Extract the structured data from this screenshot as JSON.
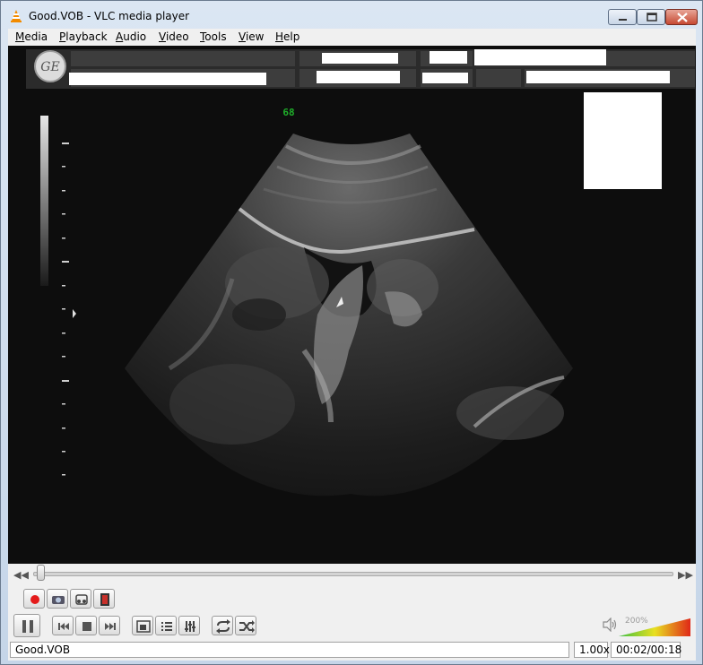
{
  "window": {
    "title": "Good.VOB - VLC media player",
    "icon": "vlc-cone-icon"
  },
  "menu": {
    "items": [
      {
        "accel": "M",
        "rest": "edia"
      },
      {
        "accel": "P",
        "rest": "layback"
      },
      {
        "accel": "A",
        "rest": "udio"
      },
      {
        "accel": "V",
        "rest": "ideo"
      },
      {
        "accel": "T",
        "rest": "ools"
      },
      {
        "accel": "V",
        "rest": "iew"
      },
      {
        "accel": "H",
        "rest": "elp"
      }
    ]
  },
  "video": {
    "logo_icon": "ge-logo",
    "overlay_label": "68",
    "overlay_color": "#1fae2a",
    "content": "ultrasound-scan"
  },
  "controls": {
    "seek_position": 0.011,
    "advanced_row": [
      "record-icon",
      "snapshot-icon",
      "loop-ab-icon",
      "frame-step-icon"
    ],
    "main_row": [
      "pause-icon",
      "previous-icon",
      "stop-icon",
      "next-icon",
      "fullscreen-icon",
      "playlist-icon",
      "extended-settings-icon",
      "loop-icon",
      "shuffle-icon"
    ],
    "volume_label": "200%",
    "volume_level": 1.0
  },
  "status": {
    "filename": "Good.VOB",
    "speed": "1.00x",
    "time": "00:02/00:18"
  }
}
